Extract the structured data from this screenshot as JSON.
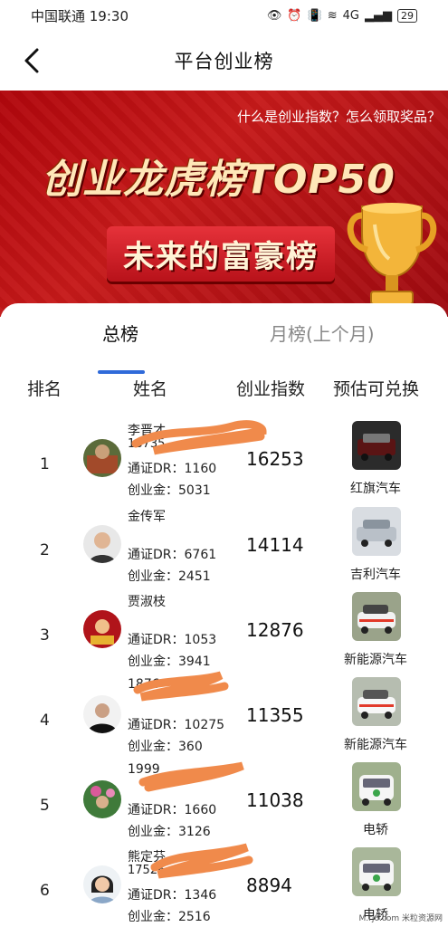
{
  "status_bar": {
    "carrier_time": "中国联通 19:30",
    "signal": "4G",
    "battery": "29"
  },
  "nav": {
    "title": "平台创业榜"
  },
  "banner": {
    "link": "什么是创业指数？怎么领取奖品？",
    "title": "创业龙虎榜TOP50",
    "subtitle": "未来的富豪榜"
  },
  "tabs": {
    "total": "总榜",
    "monthly": "月榜(上个月)"
  },
  "columns": {
    "rank": "排名",
    "name": "姓名",
    "index": "创业指数",
    "prize": "预估可兑换"
  },
  "rows": [
    {
      "rank": "1",
      "name": "李晋才",
      "phone": "18735",
      "dr": "通证DR：1160",
      "fund": "创业金：5031",
      "index": "16253",
      "prize": "红旗汽车"
    },
    {
      "rank": "2",
      "name": "金传军",
      "phone": "",
      "dr": "通证DR：6761",
      "fund": "创业金：2451",
      "index": "14114",
      "prize": "吉利汽车"
    },
    {
      "rank": "3",
      "name": "贾淑枝",
      "phone": "",
      "dr": "通证DR：1053",
      "fund": "创业金：3941",
      "index": "12876",
      "prize": "新能源汽车"
    },
    {
      "rank": "4",
      "name": "1876",
      "phone": "",
      "dr": "通证DR：10275",
      "fund": "创业金：360",
      "index": "11355",
      "prize": "新能源汽车"
    },
    {
      "rank": "5",
      "name": "1999",
      "phone": "",
      "dr": "通证DR：1660",
      "fund": "创业金：3126",
      "index": "11038",
      "prize": "电轿"
    },
    {
      "rank": "6",
      "name": "熊定芬",
      "phone": "17526",
      "dr": "通证DR：1346",
      "fund": "创业金：2516",
      "index": "8894",
      "prize": "电轿"
    }
  ],
  "watermark": "M.rj0.com 米粒资源网",
  "colors": {
    "accent": "#2f6ad9",
    "banner_red": "#b1060c",
    "scribble": "#f08a4b"
  }
}
